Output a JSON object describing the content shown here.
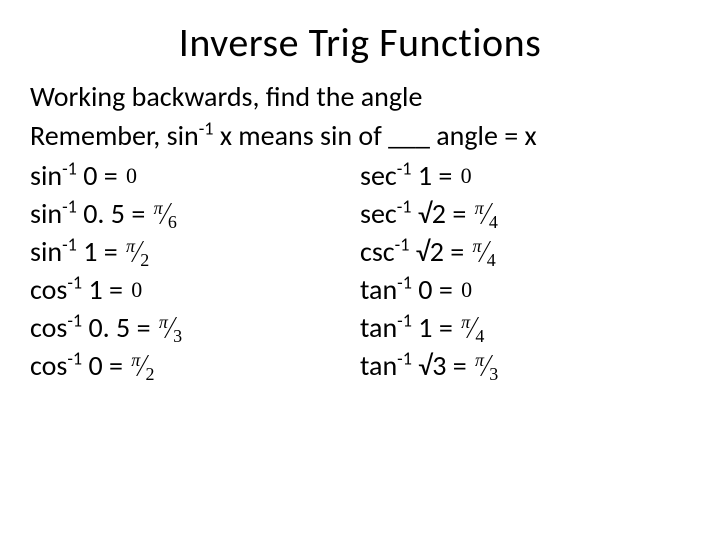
{
  "title": "Inverse Trig Functions",
  "intro": [
    "Working backwards, find the angle",
    {
      "pre": "Remember, sin",
      "sup": "-1",
      "post": " x means sin of ___ angle = x"
    }
  ],
  "left": [
    {
      "fn": "sin",
      "sup": "-1",
      "arg": " 0 = ",
      "ans": {
        "type": "zero",
        "text": "0"
      }
    },
    {
      "fn": "sin",
      "sup": "-1",
      "arg": " 0. 5 = ",
      "ans": {
        "type": "frac",
        "num": "π",
        "den": "6"
      }
    },
    {
      "fn": "sin",
      "sup": "-1",
      "arg": " 1 = ",
      "ans": {
        "type": "frac",
        "num": "π",
        "den": "2"
      }
    },
    {
      "fn": "cos",
      "sup": "-1",
      "arg": " 1 = ",
      "ans": {
        "type": "zero",
        "text": "0"
      }
    },
    {
      "fn": "cos",
      "sup": "-1",
      "arg": " 0. 5 = ",
      "ans": {
        "type": "frac",
        "num": "π",
        "den": "3"
      }
    },
    {
      "fn": "cos",
      "sup": "-1",
      "arg": " 0 = ",
      "ans": {
        "type": "frac",
        "num": "π",
        "den": "2"
      }
    }
  ],
  "right": [
    {
      "fn": "sec",
      "sup": "-1",
      "arg": " 1 = ",
      "ans": {
        "type": "zero",
        "text": "0"
      }
    },
    {
      "fn": "sec",
      "sup": "-1",
      "arg": " √2 = ",
      "ans": {
        "type": "frac",
        "num": "π",
        "den": "4"
      }
    },
    {
      "fn": "csc",
      "sup": "-1",
      "arg": " √2 = ",
      "ans": {
        "type": "frac",
        "num": "π",
        "den": "4"
      }
    },
    {
      "fn": "tan",
      "sup": "-1",
      "arg": " 0 = ",
      "ans": {
        "type": "zero",
        "text": "0"
      }
    },
    {
      "fn": "tan",
      "sup": "-1",
      "arg": " 1 = ",
      "ans": {
        "type": "frac",
        "num": "π",
        "den": "4"
      }
    },
    {
      "fn": "tan",
      "sup": "-1",
      "arg": " √3 = ",
      "ans": {
        "type": "frac",
        "num": "π",
        "den": "3"
      }
    }
  ]
}
